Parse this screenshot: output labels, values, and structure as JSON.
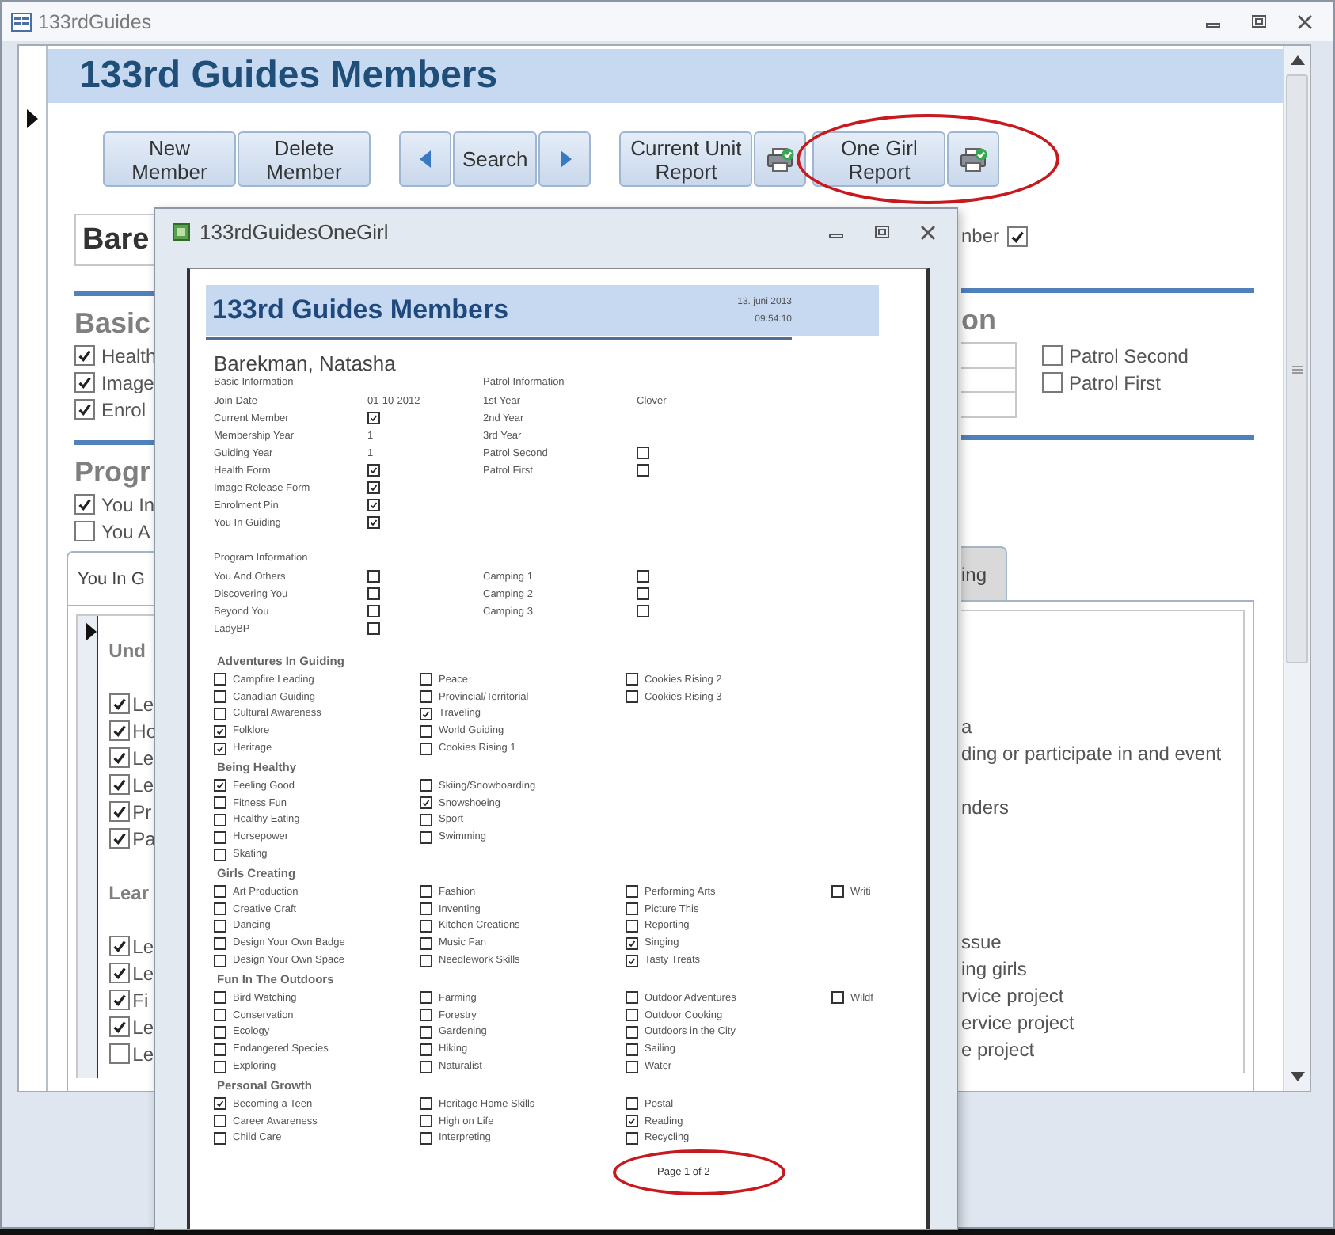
{
  "window": {
    "title": "133rdGuides"
  },
  "form": {
    "title": "133rd Guides Members",
    "toolbar": [
      {
        "highlighted": false,
        "buttons": [
          {
            "kind": "text",
            "label": "New Member"
          },
          {
            "kind": "text",
            "label": "Delete Member"
          }
        ]
      },
      {
        "highlighted": false,
        "buttons": [
          {
            "kind": "prev"
          },
          {
            "kind": "text",
            "label": "Search"
          },
          {
            "kind": "next"
          }
        ]
      },
      {
        "highlighted": false,
        "buttons": [
          {
            "kind": "text",
            "label": "Current Unit Report"
          },
          {
            "kind": "print"
          }
        ]
      },
      {
        "highlighted": true,
        "buttons": [
          {
            "kind": "text",
            "label": "One Girl Report"
          },
          {
            "kind": "print"
          }
        ]
      }
    ],
    "name_field": "Bare",
    "member_check": {
      "label": "nber",
      "checked": true
    },
    "basic": {
      "heading": "Basic",
      "checks": [
        {
          "label": "Health",
          "checked": true
        },
        {
          "label": "Image",
          "checked": true
        },
        {
          "label": "Enrol",
          "checked": true
        }
      ]
    },
    "patrol": {
      "heading": "on",
      "checks": [
        {
          "label": "Patrol Second",
          "checked": false
        },
        {
          "label": "Patrol First",
          "checked": false
        }
      ]
    },
    "program": {
      "heading": "Progr",
      "checks": [
        {
          "label": "You In",
          "checked": true
        },
        {
          "label": "You A",
          "checked": false
        }
      ]
    },
    "tabs": [
      {
        "label": "You In G",
        "selected": true
      },
      {
        "label": "ing",
        "selected": false
      }
    ],
    "subform_rows": [
      {
        "kind": "heading",
        "label": "Und"
      },
      {
        "kind": "gap"
      },
      {
        "kind": "check",
        "label": "Le",
        "checked": true
      },
      {
        "kind": "check",
        "label": "Ho",
        "checked": true,
        "text": "a"
      },
      {
        "kind": "check",
        "label": "Le",
        "checked": true,
        "text": "ding or participate in and event"
      },
      {
        "kind": "check",
        "label": "Le",
        "checked": true
      },
      {
        "kind": "check",
        "label": "Pr",
        "checked": true,
        "text": "nders"
      },
      {
        "kind": "check",
        "label": "Pa",
        "checked": true
      },
      {
        "kind": "gap"
      },
      {
        "kind": "heading",
        "label": "Lear"
      },
      {
        "kind": "gap"
      },
      {
        "kind": "check",
        "label": "Le",
        "checked": true,
        "text": "ssue"
      },
      {
        "kind": "check",
        "label": "Le",
        "checked": true,
        "text": "ing girls"
      },
      {
        "kind": "check",
        "label": "Fi",
        "checked": true,
        "text": "rvice project"
      },
      {
        "kind": "check",
        "label": "Le",
        "checked": true,
        "text": "ervice project"
      },
      {
        "kind": "check",
        "label": "Le",
        "checked": false,
        "text": "e project"
      }
    ]
  },
  "report_window": {
    "title": "133rdGuidesOneGirl",
    "report": {
      "title": "133rd Guides Members",
      "date": "13. juni 2013",
      "time": "09:54:10",
      "name": "Barekman, Natasha",
      "basic": {
        "heading": "Basic Information",
        "rows": [
          {
            "kind": "text",
            "label": "Join Date",
            "value": "01-10-2012"
          },
          {
            "kind": "check",
            "label": "Current Member",
            "checked": true
          },
          {
            "kind": "text",
            "label": "Membership Year",
            "value": "1"
          },
          {
            "kind": "text",
            "label": "Guiding Year",
            "value": "1"
          },
          {
            "kind": "check",
            "label": "Health Form",
            "checked": true
          },
          {
            "kind": "check",
            "label": "Image Release Form",
            "checked": true
          },
          {
            "kind": "check",
            "label": "Enrolment Pin",
            "checked": true
          },
          {
            "kind": "check",
            "label": "You In Guiding",
            "checked": true
          }
        ]
      },
      "patrol": {
        "heading": "Patrol Information",
        "rows": [
          {
            "kind": "text",
            "label": "1st Year",
            "value": "Clover"
          },
          {
            "kind": "text",
            "label": "2nd Year"
          },
          {
            "kind": "text",
            "label": "3rd Year"
          },
          {
            "kind": "check",
            "label": "Patrol Second",
            "checked": false
          },
          {
            "kind": "check",
            "label": "Patrol First",
            "checked": false
          }
        ]
      },
      "program": {
        "heading": "Program Information",
        "left": [
          {
            "label": "You And Others",
            "checked": false
          },
          {
            "label": "Discovering You",
            "checked": false
          },
          {
            "label": "Beyond You",
            "checked": false
          },
          {
            "label": "LadyBP",
            "checked": false
          }
        ],
        "right": [
          {
            "label": "Camping 1",
            "checked": false
          },
          {
            "label": "Camping 2",
            "checked": false
          },
          {
            "label": "Camping 3",
            "checked": false
          }
        ]
      },
      "badge_groups": [
        {
          "heading": "Adventures In Guiding",
          "columns": [
            [
              {
                "label": "Campfire Leading",
                "checked": false
              },
              {
                "label": "Canadian Guiding",
                "checked": false
              },
              {
                "label": "Cultural Awareness",
                "checked": false
              },
              {
                "label": "Folklore",
                "checked": true
              },
              {
                "label": "Heritage",
                "checked": true
              }
            ],
            [
              {
                "label": "Peace",
                "checked": false
              },
              {
                "label": "Provincial/Territorial",
                "checked": false
              },
              {
                "label": "Traveling",
                "checked": true
              },
              {
                "label": "World Guiding",
                "checked": false
              },
              {
                "label": "Cookies Rising 1",
                "checked": false
              }
            ],
            [
              {
                "label": "Cookies Rising 2",
                "checked": false
              },
              {
                "label": "Cookies Rising 3",
                "checked": false
              }
            ]
          ]
        },
        {
          "heading": "Being Healthy",
          "columns": [
            [
              {
                "label": "Feeling Good",
                "checked": true
              },
              {
                "label": "Fitness Fun",
                "checked": false
              },
              {
                "label": "Healthy Eating",
                "checked": false
              },
              {
                "label": "Horsepower",
                "checked": false
              },
              {
                "label": "Skating",
                "checked": false
              }
            ],
            [
              {
                "label": "Skiing/Snowboarding",
                "checked": false
              },
              {
                "label": "Snowshoeing",
                "checked": true
              },
              {
                "label": "Sport",
                "checked": false
              },
              {
                "label": "Swimming",
                "checked": false
              }
            ]
          ]
        },
        {
          "heading": "Girls Creating",
          "columns": [
            [
              {
                "label": "Art Production",
                "checked": false
              },
              {
                "label": "Creative Craft",
                "checked": false
              },
              {
                "label": "Dancing",
                "checked": false
              },
              {
                "label": "Design Your Own Badge",
                "checked": false
              },
              {
                "label": "Design Your Own Space",
                "checked": false
              }
            ],
            [
              {
                "label": "Fashion",
                "checked": false
              },
              {
                "label": "Inventing",
                "checked": false
              },
              {
                "label": "Kitchen Creations",
                "checked": false
              },
              {
                "label": "Music Fan",
                "checked": false
              },
              {
                "label": "Needlework Skills",
                "checked": false
              }
            ],
            [
              {
                "label": "Performing Arts",
                "checked": false
              },
              {
                "label": "Picture This",
                "checked": false
              },
              {
                "label": "Reporting",
                "checked": false
              },
              {
                "label": "Singing",
                "checked": true
              },
              {
                "label": "Tasty Treats",
                "checked": true
              }
            ],
            [
              {
                "label": "Writi",
                "checked": false
              }
            ]
          ]
        },
        {
          "heading": "Fun In The Outdoors",
          "columns": [
            [
              {
                "label": "Bird Watching",
                "checked": false
              },
              {
                "label": "Conservation",
                "checked": false
              },
              {
                "label": "Ecology",
                "checked": false
              },
              {
                "label": "Endangered Species",
                "checked": false
              },
              {
                "label": "Exploring",
                "checked": false
              }
            ],
            [
              {
                "label": "Farming",
                "checked": false
              },
              {
                "label": "Forestry",
                "checked": false
              },
              {
                "label": "Gardening",
                "checked": false
              },
              {
                "label": "Hiking",
                "checked": false
              },
              {
                "label": "Naturalist",
                "checked": false
              }
            ],
            [
              {
                "label": "Outdoor Adventures",
                "checked": false
              },
              {
                "label": "Outdoor Cooking",
                "checked": false
              },
              {
                "label": "Outdoors in the City",
                "checked": false
              },
              {
                "label": "Sailing",
                "checked": false
              },
              {
                "label": "Water",
                "checked": false
              }
            ],
            [
              {
                "label": "Wildf",
                "checked": false
              }
            ]
          ]
        },
        {
          "heading": "Personal Growth",
          "columns": [
            [
              {
                "label": "Becoming a Teen",
                "checked": true
              },
              {
                "label": "Career Awareness",
                "checked": false
              },
              {
                "label": "Child Care",
                "checked": false
              }
            ],
            [
              {
                "label": "Heritage Home Skills",
                "checked": false
              },
              {
                "label": "High on Life",
                "checked": false
              },
              {
                "label": "Interpreting",
                "checked": false
              }
            ],
            [
              {
                "label": "Postal",
                "checked": false
              },
              {
                "label": "Reading",
                "checked": true
              },
              {
                "label": "Recycling",
                "checked": false
              }
            ]
          ]
        }
      ],
      "page_number": {
        "text": "Page 1 of 2",
        "highlighted": true
      }
    }
  }
}
